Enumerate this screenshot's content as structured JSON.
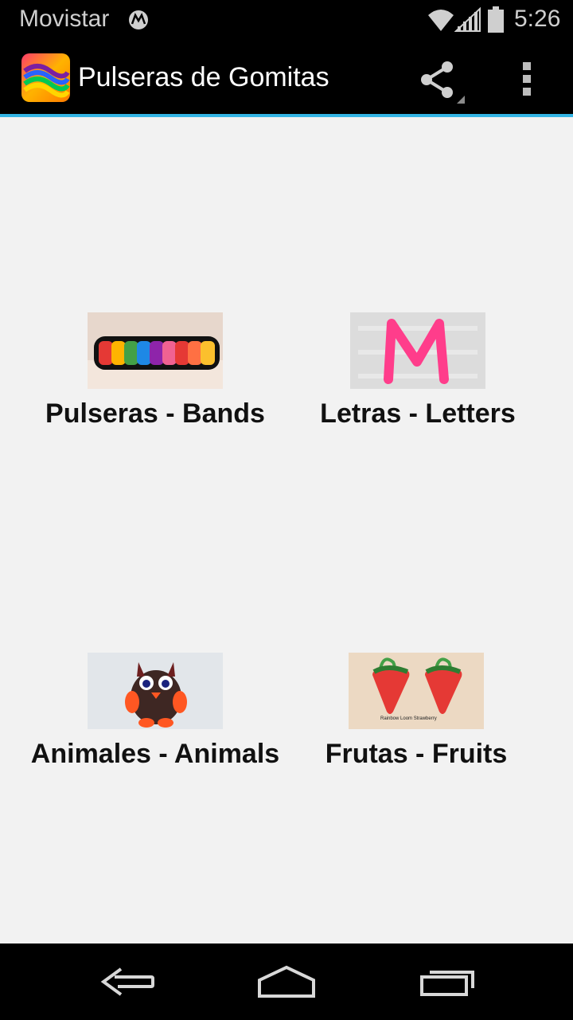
{
  "status": {
    "carrier": "Movistar",
    "time": "5:26"
  },
  "action_bar": {
    "title": "Pulseras de Gomitas",
    "share_icon": "share-icon",
    "overflow_icon": "overflow-menu-icon"
  },
  "categories": [
    {
      "label": "Pulseras - Bands",
      "thumbnail": "rainbow-bracelet-image"
    },
    {
      "label": "Letras - Letters",
      "thumbnail": "pink-letter-m-image"
    },
    {
      "label": "Animales - Animals",
      "thumbnail": "loom-animal-image"
    },
    {
      "label": "Frutas - Fruits",
      "thumbnail": "loom-strawberry-image",
      "caption": "Rainbow Loom Strawberry"
    }
  ],
  "nav": {
    "back_icon": "back-icon",
    "home_icon": "home-icon",
    "recent_icon": "recent-apps-icon"
  },
  "colors": {
    "accent": "#33b5e5",
    "background": "#f2f2f2",
    "bar": "#000000"
  }
}
